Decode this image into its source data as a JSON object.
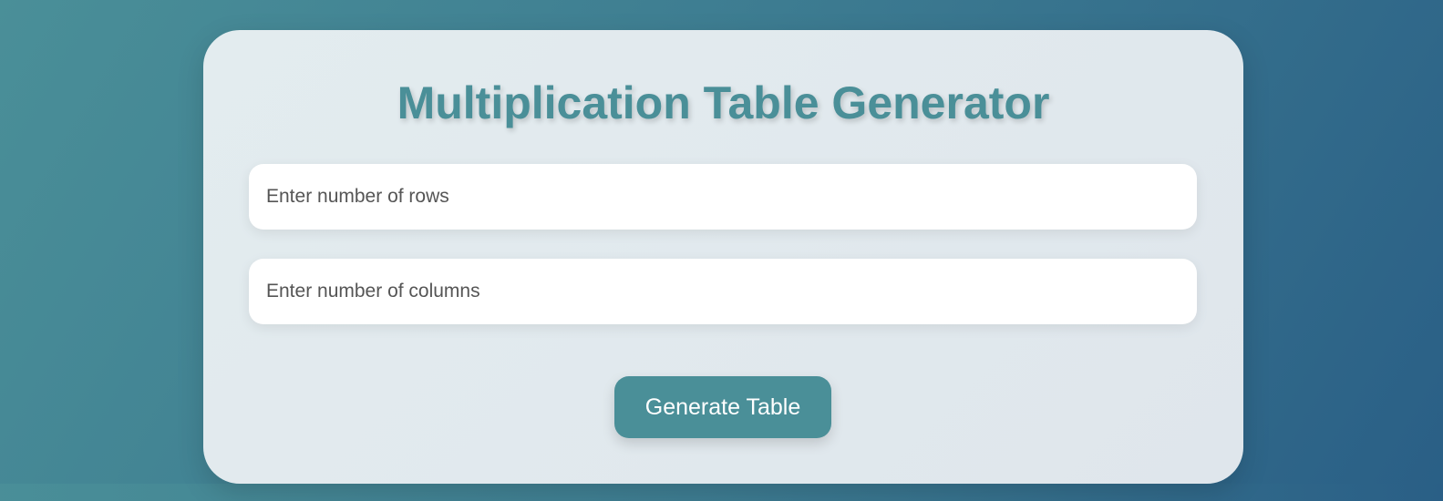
{
  "page": {
    "title": "Multiplication Table Generator"
  },
  "form": {
    "rows_placeholder": "Enter number of rows",
    "rows_value": "",
    "columns_placeholder": "Enter number of columns",
    "columns_value": "",
    "generate_label": "Generate Table"
  },
  "colors": {
    "accent": "#4a8f98",
    "background_start": "#4a8f98",
    "background_end": "#2a5f86",
    "card": "#e3ecef"
  }
}
